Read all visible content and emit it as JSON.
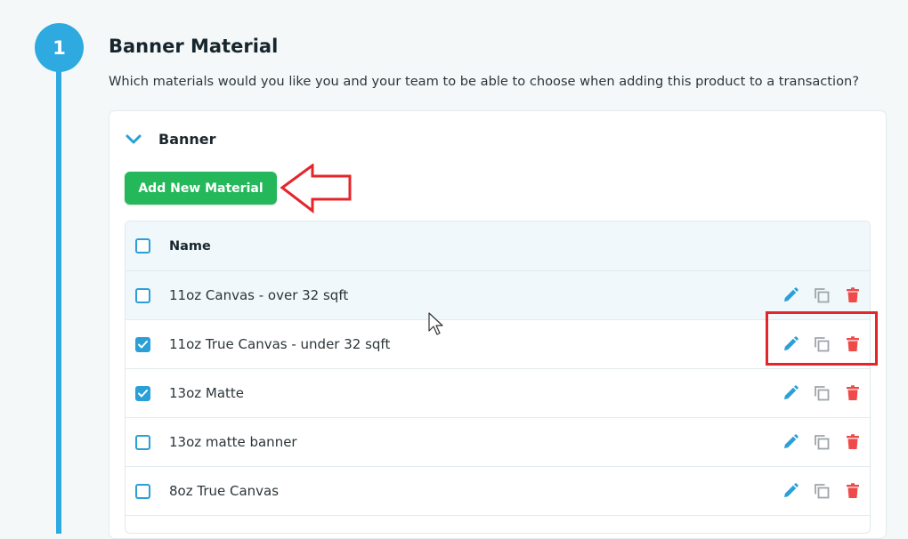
{
  "step": {
    "number": "1"
  },
  "section": {
    "title": "Banner Material",
    "description": "Which materials would you like you and your team to be able to choose when adding this product to a transaction?"
  },
  "group": {
    "title": "Banner",
    "add_button_label": "Add New Material"
  },
  "table": {
    "header_name": "Name",
    "rows": [
      {
        "name": "11oz Canvas - over 32 sqft",
        "checked": false
      },
      {
        "name": "11oz True Canvas - under 32 sqft",
        "checked": true
      },
      {
        "name": "13oz Matte",
        "checked": true
      },
      {
        "name": "13oz matte banner",
        "checked": false
      },
      {
        "name": "8oz True Canvas",
        "checked": false
      }
    ]
  },
  "colors": {
    "accent": "#2eaae1",
    "primary_button": "#25b85a",
    "edit_icon": "#2a9fd8",
    "copy_icon": "#9ea6aa",
    "delete_icon": "#ef4a4a",
    "annotation": "#e4262b"
  },
  "icons": {
    "toggle": "chevron-down-icon",
    "edit": "pencil-icon",
    "copy": "copy-icon",
    "delete": "trash-icon",
    "callout": "arrow-left-icon"
  }
}
